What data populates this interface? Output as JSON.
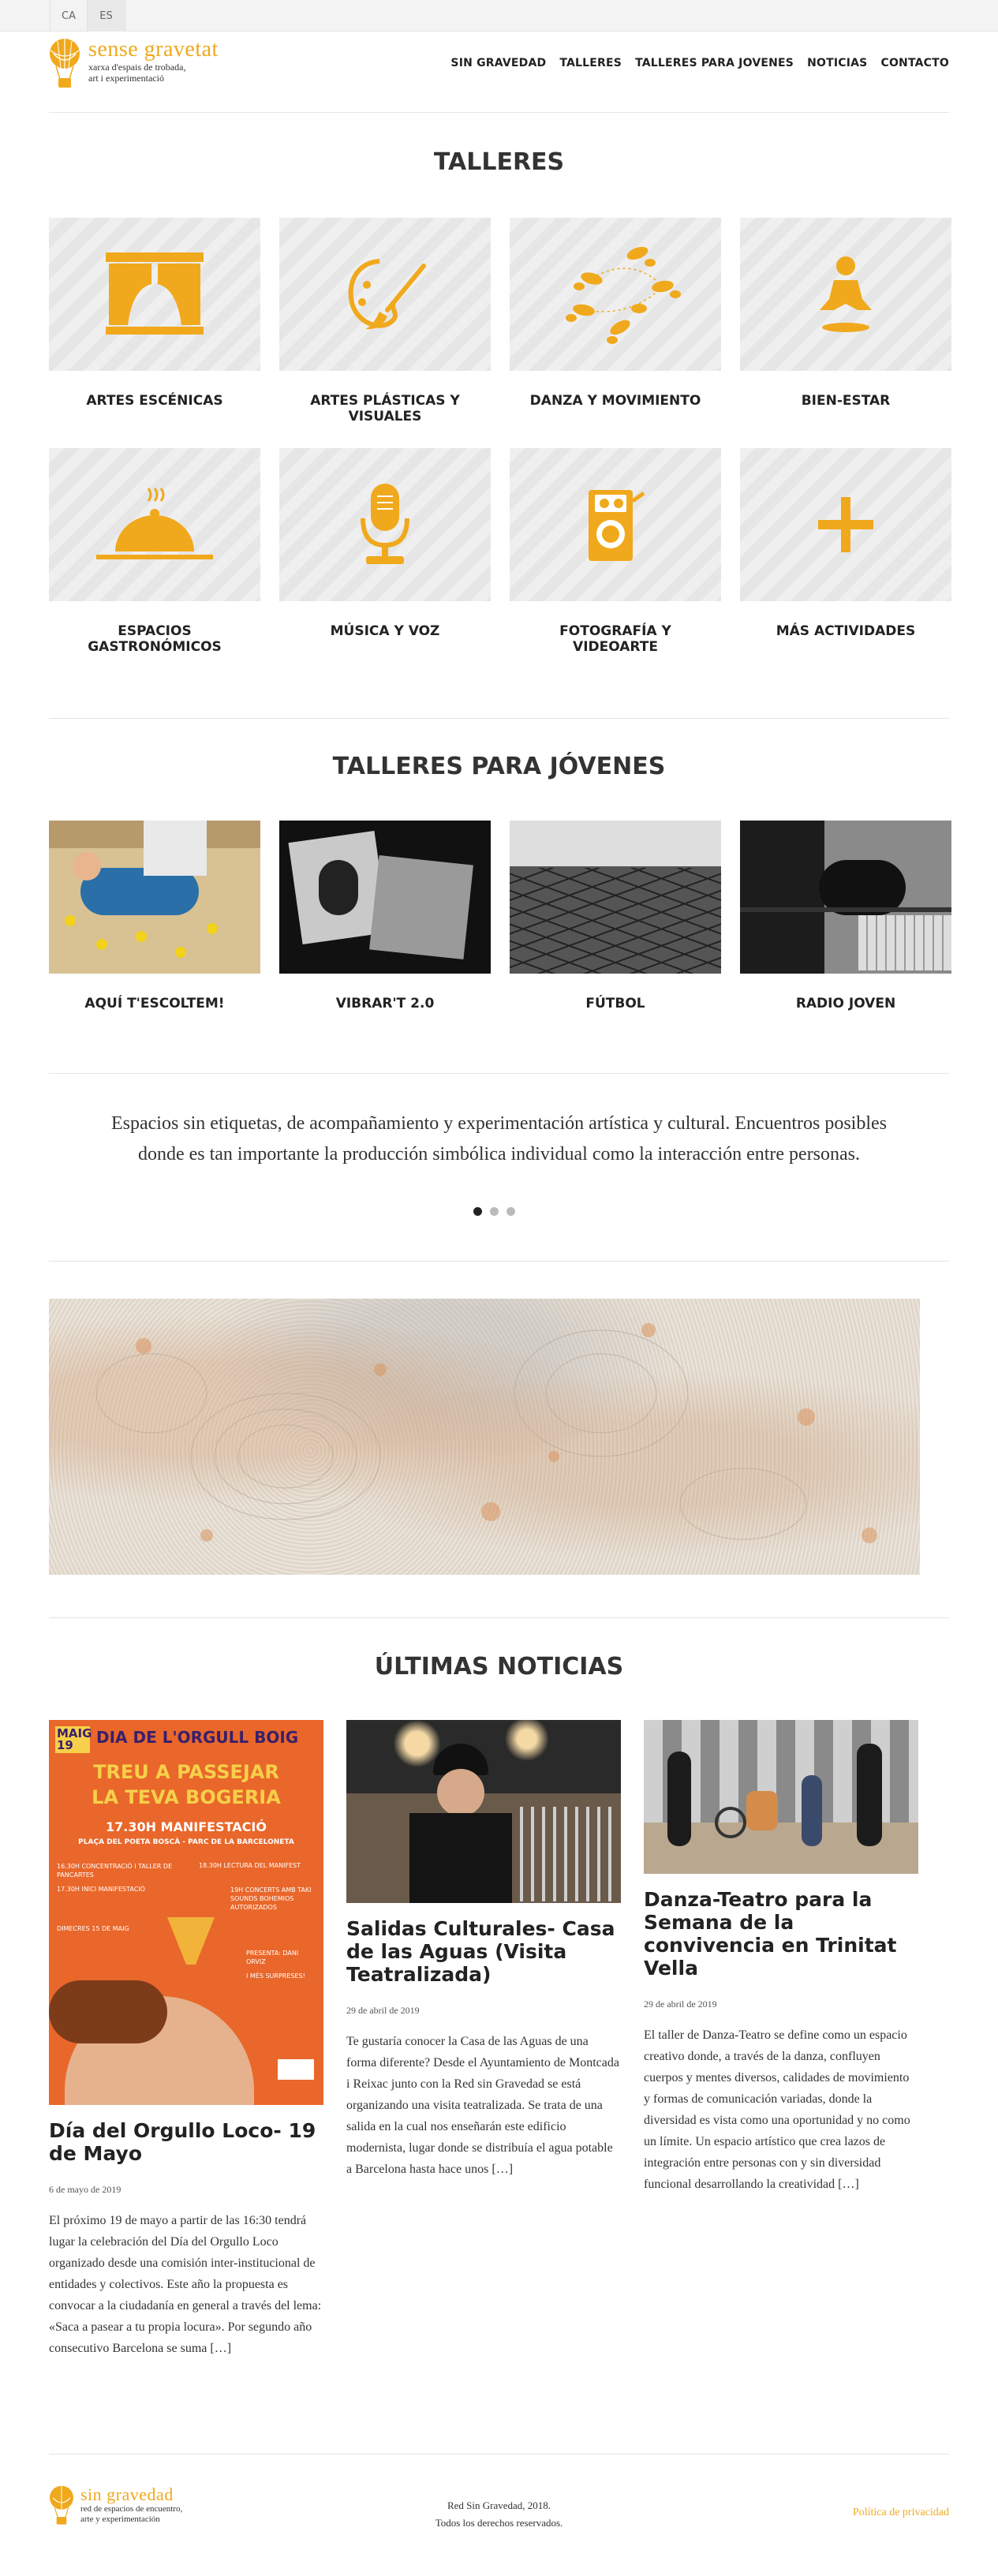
{
  "lang": {
    "ca": "CA",
    "es": "ES"
  },
  "brand": {
    "name": "sense gravetat",
    "tagline_1": "xarxa d'espais de trobada,",
    "tagline_2": "art i experimentació",
    "accent": "#f0a91c"
  },
  "nav": [
    "SIN GRAVEDAD",
    "TALLERES",
    "TALLERES PARA JOVENES",
    "NOTICIAS",
    "CONTACTO"
  ],
  "talleres": {
    "title": "TALLERES",
    "items": [
      {
        "label": "ARTES ESCÉNICAS",
        "icon": "theater-curtain-icon"
      },
      {
        "label": "ARTES PLÁSTICAS Y VISUALES",
        "icon": "palette-brush-icon"
      },
      {
        "label": "DANZA Y MOVIMIENTO",
        "icon": "footsteps-icon"
      },
      {
        "label": "BIEN-ESTAR",
        "icon": "meditation-icon"
      },
      {
        "label": "ESPACIOS GASTRONÓMICOS",
        "icon": "serving-cloche-icon"
      },
      {
        "label": "MÚSICA Y VOZ",
        "icon": "microphone-icon"
      },
      {
        "label": "FOTOGRAFÍA Y VIDEOARTE",
        "icon": "camera-icon"
      },
      {
        "label": "MÁS ACTIVIDADES",
        "icon": "plus-icon"
      }
    ]
  },
  "jovenes": {
    "title": "TALLERES PARA JÓVENES",
    "items": [
      {
        "label": "AQUÍ T'ESCOLTEM!"
      },
      {
        "label": "VIBRAR'T 2.0"
      },
      {
        "label": "FÚTBOL"
      },
      {
        "label": "RADIO JOVEN"
      }
    ]
  },
  "quote": "Espacios sin etiquetas, de acompañamiento y experimentación artística y cultural. Encuentros posibles donde es tan importante la producción simbólica individual como la interacción entre personas.",
  "noticias": {
    "title": "ÚLTIMAS NOTICIAS",
    "poster": {
      "date_line": "MAIG 19",
      "headline": "DIA DE L'ORGULL BOIG",
      "slogan_1": "TREU A PASSEJAR",
      "slogan_2": "LA TEVA BOGERIA",
      "event": "17.30H MANIFESTACIÓ",
      "place_1": "PLAÇA DEL POETA BOSCÀ - PARC DE LA BARCELONETA",
      "schedule_left": "16.30H CONCENTRACIÓ I TALLER DE PANCARTES",
      "schedule_left_2": "17.30H INICI MANIFESTACIÓ",
      "schedule_right": "18.30H LECTURA DEL MANIFEST",
      "schedule_right_2": "19H CONCERTS AMB TAKI SOUNDS BOHEMIOS AUTORIZADOS",
      "extra": "DIMECRES 15 DE MAIG",
      "presenta": "PRESENTA: DANI ORVIZ",
      "surprise": "I MÉS SURPRESES!"
    },
    "cards": [
      {
        "title": "Día del Orgullo Loco- 19 de Mayo",
        "date": "6 de mayo de 2019",
        "body": "El próximo 19 de mayo a partir de las 16:30 tendrá lugar la celebración del Día del Orgullo Loco organizado desde una comisión inter-institucional de entidades y colectivos. Este año la propuesta es convocar a la ciudadanía en general a través del lema: «Saca a pasear a tu propia locura». Por segundo año consecutivo Barcelona se suma […]"
      },
      {
        "title": "Salidas Culturales- Casa de las Aguas (Visita Teatralizada)",
        "date": "29 de abril de 2019",
        "body": "Te gustaría conocer la Casa de las Aguas de una forma diferente? Desde el Ayuntamiento de Montcada i Reixac junto con la Red sin Gravedad se está organizando una visita teatralizada. Se trata de una salida en la cual nos enseñarán este edificio modernista, lugar donde se distribuía el agua potable a Barcelona hasta hace unos […]"
      },
      {
        "title": "Danza-Teatro para la Semana de la convivencia en Trinitat Vella",
        "date": "29 de abril de 2019",
        "body": "El taller de Danza-Teatro se define como un espacio creativo donde, a través de la danza, confluyen cuerpos y mentes diversos, calidades de movimiento y formas de comunicación variadas, donde la diversidad es vista como una oportunidad y no como un límite. Un espacio artístico que crea lazos de integración entre personas con y sin diversidad funcional desarrollando la creatividad […]"
      }
    ]
  },
  "footer": {
    "brand": "sin gravedad",
    "tagline_1": "red de espacios de encuentro,",
    "tagline_2": "arte y experimentación",
    "copy_1": "Red Sin Gravedad, 2018.",
    "copy_2": "Todos los derechos reservados.",
    "privacy": "Política de privacidad"
  }
}
